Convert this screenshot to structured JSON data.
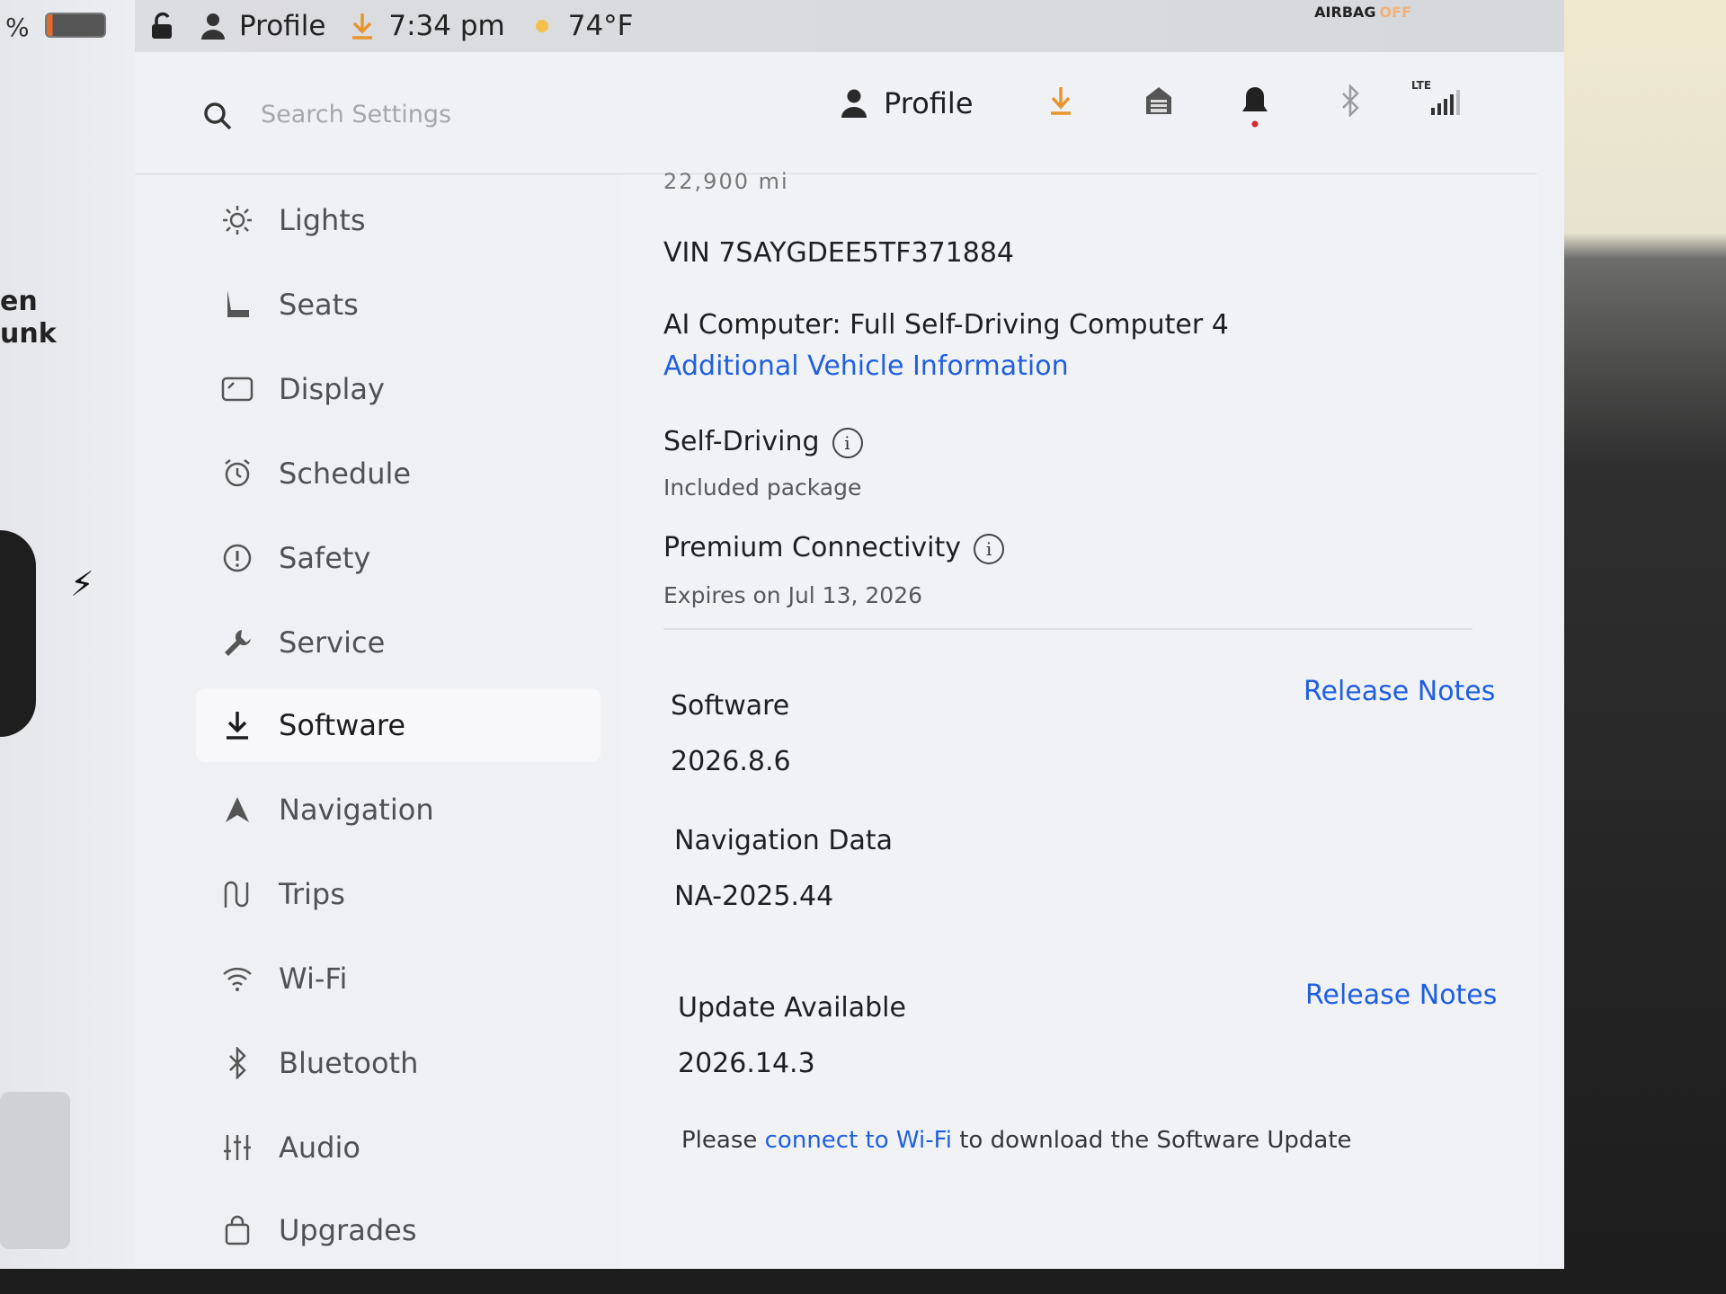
{
  "status_bar": {
    "battery_percent_symbol": "%",
    "profile_label": "Profile",
    "time": "7:34 pm",
    "temperature": "74°F",
    "airbag_label": "AIRBAG",
    "airbag_state": "OFF"
  },
  "left_panel": {
    "side_text_1": "en",
    "side_text_2": "unk"
  },
  "header": {
    "search_placeholder": "Search Settings",
    "profile_label": "Profile",
    "lte_label": "LTE",
    "accent_color": "#e8952f",
    "alert_color": "#d9272e"
  },
  "sidebar": {
    "items": [
      {
        "label": "Lights",
        "icon": "lights-icon"
      },
      {
        "label": "Seats",
        "icon": "seat-icon"
      },
      {
        "label": "Display",
        "icon": "display-icon"
      },
      {
        "label": "Schedule",
        "icon": "schedule-icon"
      },
      {
        "label": "Safety",
        "icon": "safety-icon"
      },
      {
        "label": "Service",
        "icon": "wrench-icon"
      },
      {
        "label": "Software",
        "icon": "download-icon",
        "active": true
      },
      {
        "label": "Navigation",
        "icon": "navigation-icon"
      },
      {
        "label": "Trips",
        "icon": "trips-icon"
      },
      {
        "label": "Wi-Fi",
        "icon": "wifi-icon"
      },
      {
        "label": "Bluetooth",
        "icon": "bluetooth-icon"
      },
      {
        "label": "Audio",
        "icon": "audio-icon"
      },
      {
        "label": "Upgrades",
        "icon": "bag-icon"
      }
    ]
  },
  "content": {
    "odometer_partial": "22,900 mi",
    "vin": "VIN 7SAYGDEE5TF371884",
    "ai_computer": "AI Computer: Full Self-Driving Computer 4",
    "additional_info_link": "Additional Vehicle Information",
    "self_driving_title": "Self-Driving",
    "self_driving_sub": "Included package",
    "connectivity_title": "Premium Connectivity",
    "connectivity_sub": "Expires on Jul 13, 2026",
    "software_title": "Software",
    "software_version": "2026.8.6",
    "release_notes_1": "Release Notes",
    "nav_data_title": "Navigation Data",
    "nav_data_version": "NA-2025.44",
    "update_title": "Update Available",
    "update_version": "2026.14.3",
    "release_notes_2": "Release Notes",
    "notice_prefix": "Please",
    "notice_link": "connect to Wi-Fi",
    "notice_suffix": "to download the Software Update",
    "link_color": "#1f5fe0"
  }
}
